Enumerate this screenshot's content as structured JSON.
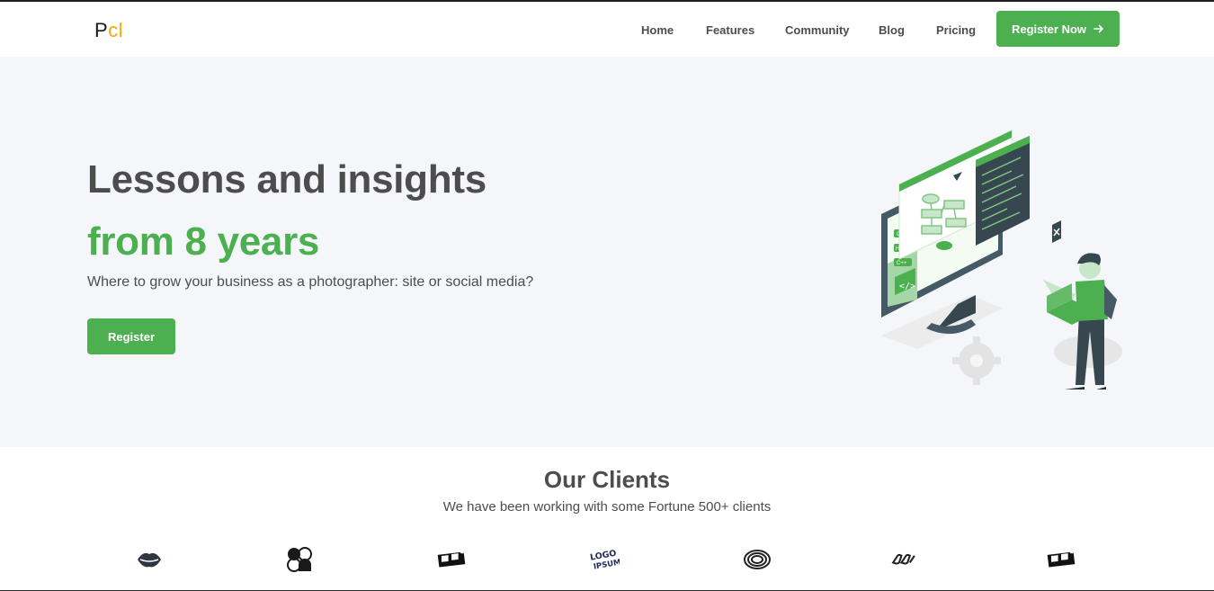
{
  "header": {
    "logo_p": "P",
    "logo_cl": "cl",
    "nav": [
      {
        "label": "Home"
      },
      {
        "label": "Features"
      },
      {
        "label": "Community"
      },
      {
        "label": "Blog"
      },
      {
        "label": "Pricing"
      }
    ],
    "cta_label": "Register Now",
    "cta_icon": "arrow-right-icon"
  },
  "hero": {
    "title": "Lessons and insights",
    "title_accent": "from 8 years",
    "subtitle": "Where to grow your business as a photographer: site or social media?",
    "button_label": "Register",
    "illustration_labels": [
      "CSS",
      "HTML",
      "C++"
    ]
  },
  "clients": {
    "title": "Our Clients",
    "subtitle": "We have been working with some Fortune 500+ clients",
    "logo_wordmark": "LOGO IPSUM",
    "logos": [
      "lips-logo-icon",
      "flower-logo-icon",
      "block-logo-icon",
      "logo-ipsum-icon",
      "spiral-logo-icon",
      "chain-logo-icon",
      "block-logo-icon"
    ]
  },
  "colors": {
    "accent": "#4caf50",
    "logo_accent": "#f2a900",
    "text": "#4d4d4d",
    "hero_bg": "#f5f6fa"
  }
}
